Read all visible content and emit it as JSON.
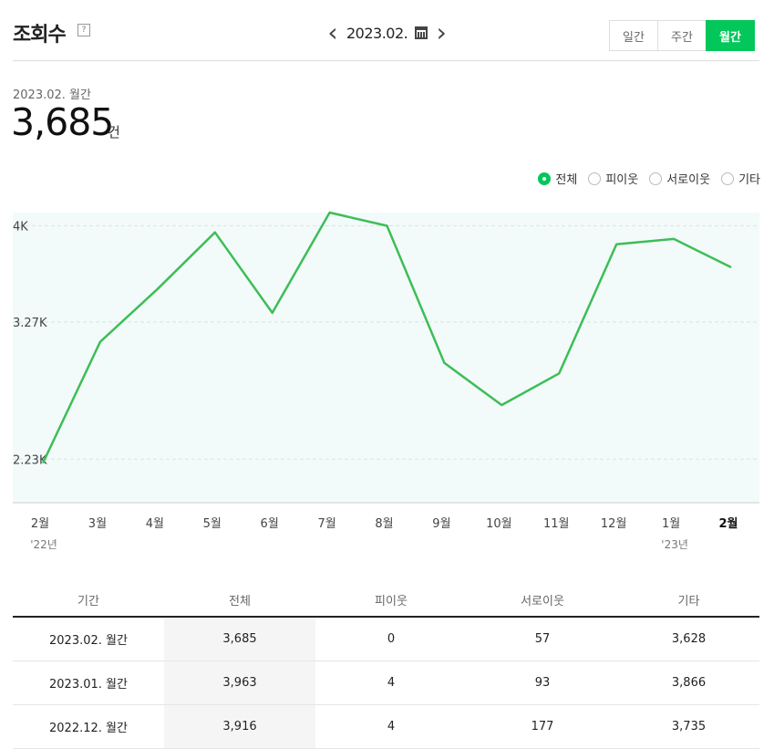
{
  "header": {
    "title": "조회수",
    "help_label": "?",
    "date": "2023.02.",
    "prev_label": "‹",
    "next_label": "›"
  },
  "period_tabs": [
    {
      "label": "일간",
      "active": false
    },
    {
      "label": "주간",
      "active": false
    },
    {
      "label": "월간",
      "active": true
    }
  ],
  "summary": {
    "period": "2023.02. 월간",
    "value": "3,685",
    "unit": "건"
  },
  "legend": [
    {
      "label": "전체",
      "selected": true
    },
    {
      "label": "피이웃",
      "selected": false
    },
    {
      "label": "서로이웃",
      "selected": false
    },
    {
      "label": "기타",
      "selected": false
    }
  ],
  "colors": {
    "accent": "#03c75a",
    "line": "#3dbe56",
    "plot_bg": "#f3fafa",
    "grid": "#d9e4e4"
  },
  "chart_data": {
    "type": "line",
    "categories": [
      "2월",
      "3월",
      "4월",
      "5월",
      "6월",
      "7월",
      "8월",
      "9월",
      "10월",
      "11월",
      "12월",
      "1월",
      "2월"
    ],
    "year_labels": [
      "'22년",
      "",
      "",
      "",
      "",
      "",
      "",
      "",
      "",
      "",
      "",
      "'23년",
      ""
    ],
    "series": [
      {
        "values": [
          2200,
          3120,
          3520,
          3950,
          3340,
          4100,
          4000,
          2960,
          2640,
          2880,
          3860,
          3900,
          3685
        ]
      }
    ],
    "yticks": [
      {
        "value": 4000,
        "label": "4K"
      },
      {
        "value": 3270,
        "label": "3.27K"
      },
      {
        "value": 2230,
        "label": "2.23K"
      }
    ],
    "ylim": [
      1900,
      4100
    ],
    "highlight_category_index": 12,
    "grid": true
  },
  "table": {
    "columns": [
      "기간",
      "전체",
      "피이웃",
      "서로이웃",
      "기타"
    ],
    "rows": [
      [
        "2023.02. 월간",
        "3,685",
        "0",
        "57",
        "3,628"
      ],
      [
        "2023.01. 월간",
        "3,963",
        "4",
        "93",
        "3,866"
      ],
      [
        "2022.12. 월간",
        "3,916",
        "4",
        "177",
        "3,735"
      ]
    ]
  }
}
